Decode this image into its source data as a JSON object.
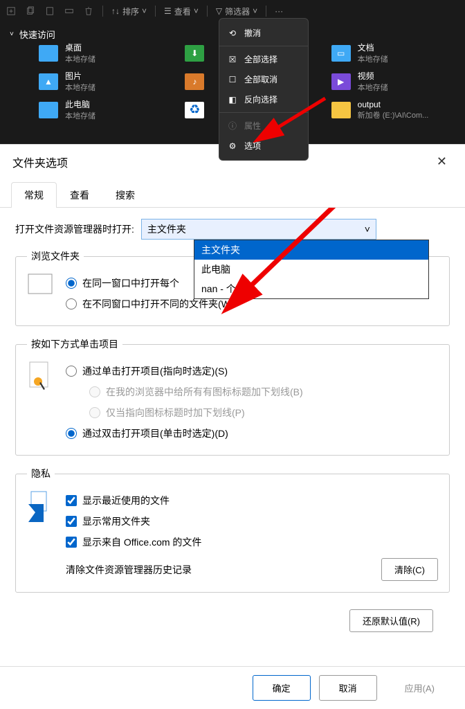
{
  "toolbar": {
    "sort_label": "排序",
    "view_label": "查看",
    "filter_label": "筛选器"
  },
  "nav": {
    "quick_access": "快速访问"
  },
  "items": [
    {
      "name": "桌面",
      "sub": "本地存储",
      "color": "#3fa9f5"
    },
    {
      "name": "",
      "sub": "",
      "color": "#2ea043",
      "icon": "download"
    },
    {
      "name": "文档",
      "sub": "本地存储",
      "color": "#3fa9f5"
    },
    {
      "name": "图片",
      "sub": "本地存储",
      "color": "#3fa9f5"
    },
    {
      "name": "",
      "sub": "",
      "color": "#d97a2b",
      "icon": "music"
    },
    {
      "name": "视频",
      "sub": "本地存储",
      "color": "#7a4bd9"
    },
    {
      "name": "此电脑",
      "sub": "本地存储",
      "color": "#3fa9f5",
      "icon": "pc"
    },
    {
      "name": "",
      "sub": "",
      "color": "#fff",
      "icon": "recycle"
    },
    {
      "name": "output",
      "sub": "新加卷 (E:)\\AI\\Com...",
      "color": "#f5c542"
    }
  ],
  "ctx": {
    "undo": "撤消",
    "select_all": "全部选择",
    "deselect_all": "全部取消",
    "invert": "反向选择",
    "properties": "属性",
    "options": "选项"
  },
  "dialog": {
    "title": "文件夹选项",
    "tabs": {
      "general": "常规",
      "view": "查看",
      "search": "搜索"
    },
    "open_explorer_label": "打开文件资源管理器时打开:",
    "combo_value": "主文件夹",
    "combo_options": [
      "主文件夹",
      "此电脑",
      "nan - 个人"
    ],
    "browse_group": "浏览文件夹",
    "browse_same": "在同一窗口中打开每个",
    "browse_diff": "在不同窗口中打开不同的文件夹(W)",
    "click_group": "按如下方式单击项目",
    "click_single": "通过单击打开项目(指向时选定)(S)",
    "click_underline_all": "在我的浏览器中给所有有图标标题加下划线(B)",
    "click_underline_point": "仅当指向图标标题时加下划线(P)",
    "click_double": "通过双击打开项目(单击时选定)(D)",
    "privacy_group": "隐私",
    "privacy_recent": "显示最近使用的文件",
    "privacy_frequent": "显示常用文件夹",
    "privacy_office": "显示来自 Office.com 的文件",
    "clear_history": "清除文件资源管理器历史记录",
    "clear_btn": "清除(C)",
    "restore_btn": "还原默认值(R)",
    "ok": "确定",
    "cancel": "取消",
    "apply": "应用(A)"
  }
}
